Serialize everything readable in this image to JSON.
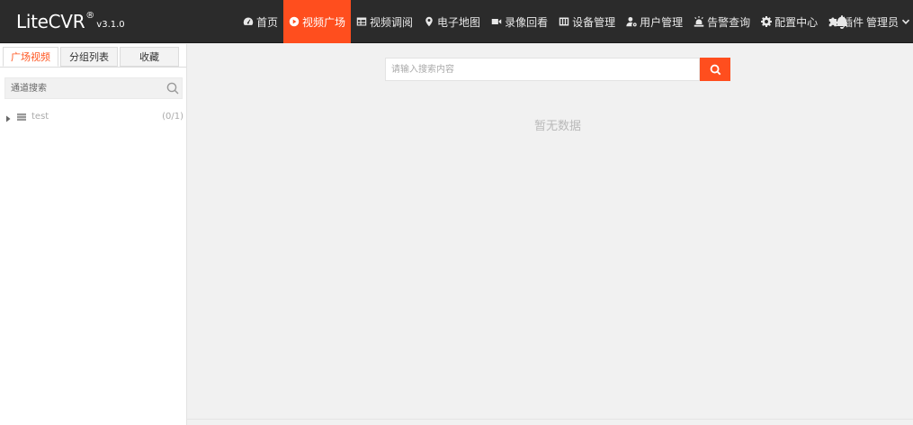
{
  "app": {
    "brand": "LiteCVR",
    "trademark": "®",
    "version": "v3.1.0"
  },
  "nav": [
    {
      "label": "首页",
      "icon": "dashboard-icon",
      "active": false
    },
    {
      "label": "视频广场",
      "icon": "play-circle-icon",
      "active": true
    },
    {
      "label": "视频调阅",
      "icon": "grid-table-icon",
      "active": false
    },
    {
      "label": "电子地图",
      "icon": "map-marker-icon",
      "active": false
    },
    {
      "label": "录像回看",
      "icon": "video-camera-icon",
      "active": false
    },
    {
      "label": "设备管理",
      "icon": "device-columns-icon",
      "active": false
    },
    {
      "label": "用户管理",
      "icon": "user-gear-icon",
      "active": false
    },
    {
      "label": "告警查询",
      "icon": "alarm-light-icon",
      "active": false
    },
    {
      "label": "配置中心",
      "icon": "gear-icon",
      "active": false
    },
    {
      "label": "插件",
      "icon": "puzzle-icon",
      "active": false
    }
  ],
  "user": {
    "name": "管理员"
  },
  "sidebar": {
    "tabs": [
      {
        "label": "广场视频",
        "active": true
      },
      {
        "label": "分组列表",
        "active": false
      },
      {
        "label": "收藏",
        "active": false
      }
    ],
    "search_placeholder": "通道搜索",
    "tree": [
      {
        "label": "test",
        "count": "(0/1)"
      }
    ]
  },
  "main": {
    "search_placeholder": "请输入搜索内容",
    "empty_text": "暂无数据"
  },
  "colors": {
    "accent": "#ff4e1e",
    "topbar": "#2b2b2b",
    "background": "#f1f1f1"
  }
}
